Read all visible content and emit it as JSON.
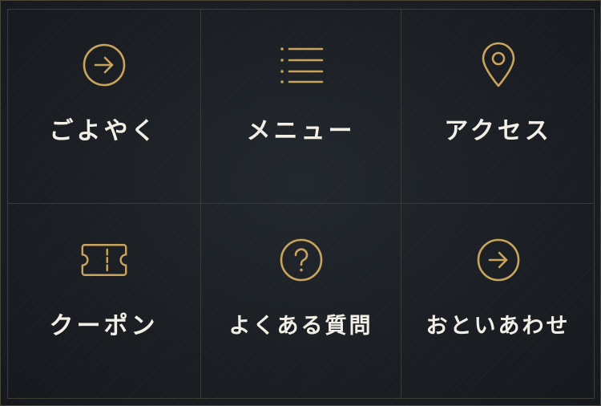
{
  "colors": {
    "accent_gold": "#c9a45c",
    "label_text": "#f2efe6",
    "background": "#1a1d21",
    "divider": "#3a3b34"
  },
  "menu": {
    "items": [
      {
        "label": "ごよやく",
        "icon": "arrow-right-circle-icon"
      },
      {
        "label": "メニュー",
        "icon": "list-icon"
      },
      {
        "label": "アクセス",
        "icon": "map-pin-icon"
      },
      {
        "label": "クーポン",
        "icon": "ticket-icon"
      },
      {
        "label": "よくある質問",
        "icon": "question-circle-icon"
      },
      {
        "label": "おといあわせ",
        "icon": "arrow-right-circle-icon"
      }
    ]
  }
}
